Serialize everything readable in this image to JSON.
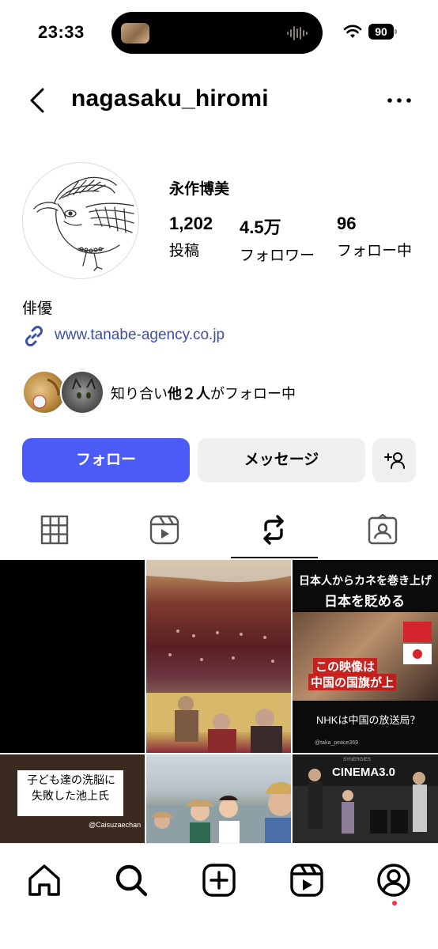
{
  "status_bar": {
    "time": "23:33",
    "battery": "90"
  },
  "header": {
    "username": "nagasaku_hiromi"
  },
  "profile": {
    "full_name": "永作博美",
    "stats": [
      {
        "value": "1,202",
        "label": "投稿"
      },
      {
        "value": "4.5万",
        "label": "フォロワー"
      },
      {
        "value": "96",
        "label": "フォロー中"
      }
    ],
    "bio": "俳優",
    "link": "www.tanabe-agency.co.jp",
    "mutual_prefix": "知り合い",
    "mutual_bold": "他２人",
    "mutual_suffix": "がフォロー中"
  },
  "buttons": {
    "follow": "フォロー",
    "message": "メッセージ"
  },
  "tabs": [
    "grid",
    "reels",
    "reposts",
    "tagged"
  ],
  "active_tab": "reposts",
  "grid": {
    "cell3": {
      "title1": "日本人からカネを巻き上げ",
      "title2": "日本を貶める",
      "red1": "この映像は",
      "red2": "中国の国旗が上",
      "question": "NHKは中国の放送局？",
      "handle": "@taka_peace369"
    },
    "cell4": {
      "line1": "子ども達の洗脳に",
      "line2": "失敗した池上氏",
      "handle": "@Caisuzaechan"
    },
    "cell6": {
      "title": "CINEMA3.0",
      "brand": "SYNERGIES"
    }
  },
  "colors": {
    "accent": "#4a5cf5",
    "link": "#3b4eaa",
    "notification": "#ff3040"
  }
}
